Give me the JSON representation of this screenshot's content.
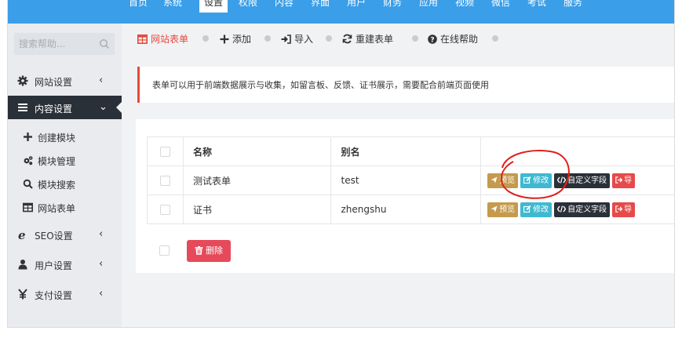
{
  "topnav": {
    "items": [
      {
        "label": "首页"
      },
      {
        "label": "系统"
      },
      {
        "label": "设置"
      },
      {
        "label": "权限"
      },
      {
        "label": "内容"
      },
      {
        "label": "界面"
      },
      {
        "label": "用户"
      },
      {
        "label": "财务"
      },
      {
        "label": "应用"
      },
      {
        "label": "视频"
      },
      {
        "label": "微信"
      },
      {
        "label": "考试"
      },
      {
        "label": "服务"
      }
    ],
    "active_index": 2,
    "color": "#3a9ee8"
  },
  "sidebar": {
    "search_placeholder": "搜索帮助...",
    "menu": [
      {
        "label": "网站设置",
        "icon": "gear-icon",
        "arrow": "‹"
      },
      {
        "label": "内容设置",
        "icon": "bars-icon",
        "arrow": "⌄"
      },
      {
        "label": "SEO设置",
        "icon": "ie-icon",
        "arrow": "‹"
      },
      {
        "label": "用户设置",
        "icon": "user-icon",
        "arrow": "‹"
      },
      {
        "label": "支付设置",
        "icon": "yen-icon",
        "arrow": "‹"
      }
    ],
    "submenu": [
      {
        "label": "创建模块",
        "icon": "plus-icon"
      },
      {
        "label": "模块管理",
        "icon": "cogs-icon"
      },
      {
        "label": "模块搜索",
        "icon": "search-icon"
      },
      {
        "label": "网站表单",
        "icon": "table-icon"
      }
    ],
    "active_color": "#2a3038"
  },
  "tabs": [
    {
      "label": "网站表单",
      "icon": "table-icon",
      "active": true
    },
    {
      "label": "添加",
      "icon": "plus-icon",
      "active": false
    },
    {
      "label": "导入",
      "icon": "sign-in-icon",
      "active": false
    },
    {
      "label": "重建表单",
      "icon": "refresh-icon",
      "active": false
    },
    {
      "label": "在线帮助",
      "icon": "question-circle-icon",
      "active": false
    }
  ],
  "notice": "表单可以用于前端数据展示与收集，如留言板、反馈、证书展示，需要配合前端页面使用",
  "table": {
    "headers": {
      "name": "名称",
      "alias": "别名",
      "ops": ""
    },
    "rows": [
      {
        "name": "测试表单",
        "alias": "test"
      },
      {
        "name": "证书",
        "alias": "zhengshu"
      }
    ],
    "buttons": {
      "preview": "预览",
      "edit": "修改",
      "custom_fields": "自定义字段",
      "export": "导"
    }
  },
  "delete_button": "删除",
  "colors": {
    "accent_red": "#e64a3b",
    "preview": "#c49a4c",
    "edit": "#3fb9d1",
    "custom": "#2a3038",
    "export": "#e64a4a",
    "annotation": "#e0201a"
  }
}
